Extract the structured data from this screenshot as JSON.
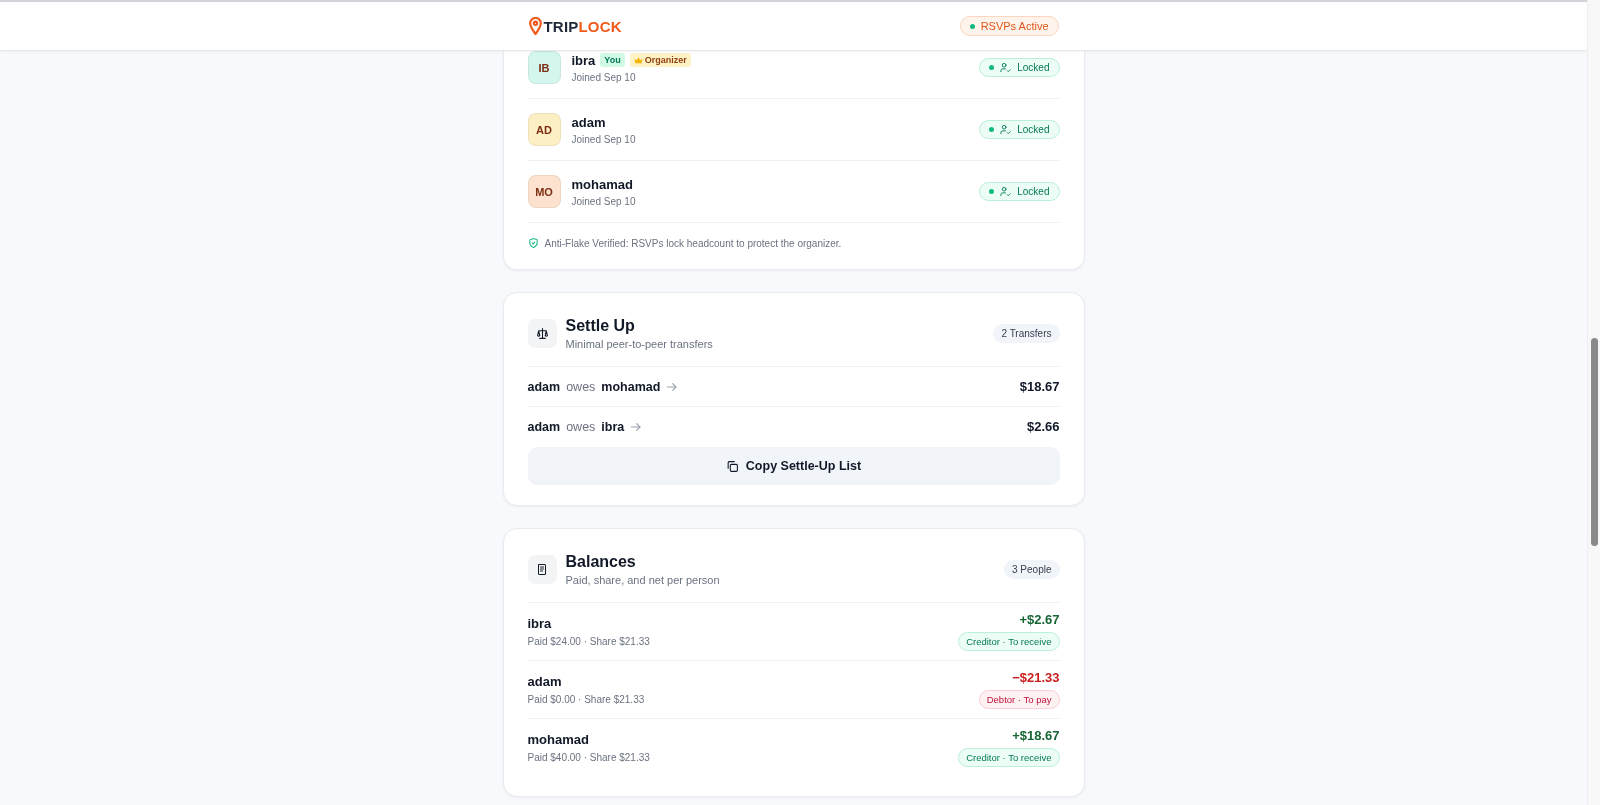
{
  "header": {
    "brand": {
      "dark": "TRIP",
      "accent": "LOCK"
    },
    "status": "RSVPs Active"
  },
  "members": {
    "rows": [
      {
        "initials": "IB",
        "color": "#d3f7ee",
        "name": "ibra",
        "badges": [
          {
            "kind": "you",
            "label": "You"
          },
          {
            "kind": "organizer",
            "label": "Organizer"
          }
        ],
        "joined": "Joined Sep 10",
        "status": "Locked"
      },
      {
        "initials": "AD",
        "color": "#fdefc4",
        "name": "adam",
        "badges": [],
        "joined": "Joined Sep 10",
        "status": "Locked"
      },
      {
        "initials": "MO",
        "color": "#fde3cf",
        "name": "mohamad",
        "badges": [],
        "joined": "Joined Sep 10",
        "status": "Locked"
      }
    ],
    "note": "Anti-Flake Verified: RSVPs lock headcount to protect the organizer."
  },
  "settle": {
    "title": "Settle Up",
    "subtitle": "Minimal peer-to-peer transfers",
    "count": "2 Transfers",
    "transfers": [
      {
        "from": "adam",
        "verb": "owes",
        "to": "mohamad",
        "amount": "$18.67"
      },
      {
        "from": "adam",
        "verb": "owes",
        "to": "ibra",
        "amount": "$2.66"
      }
    ],
    "copy_button": "Copy Settle-Up List"
  },
  "balances": {
    "title": "Balances",
    "subtitle": "Paid, share, and net per person",
    "count": "3 People",
    "rows": [
      {
        "name": "ibra",
        "detail": "Paid $24.00 · Share $21.33",
        "net": "+$2.67",
        "kind": "creditor",
        "role": "Creditor · To receive"
      },
      {
        "name": "adam",
        "detail": "Paid $0.00 · Share $21.33",
        "net": "−$21.33",
        "kind": "debtor",
        "role": "Debtor · To pay"
      },
      {
        "name": "mohamad",
        "detail": "Paid $40.00 · Share $21.33",
        "net": "+$18.67",
        "kind": "creditor",
        "role": "Creditor · To receive"
      }
    ]
  }
}
